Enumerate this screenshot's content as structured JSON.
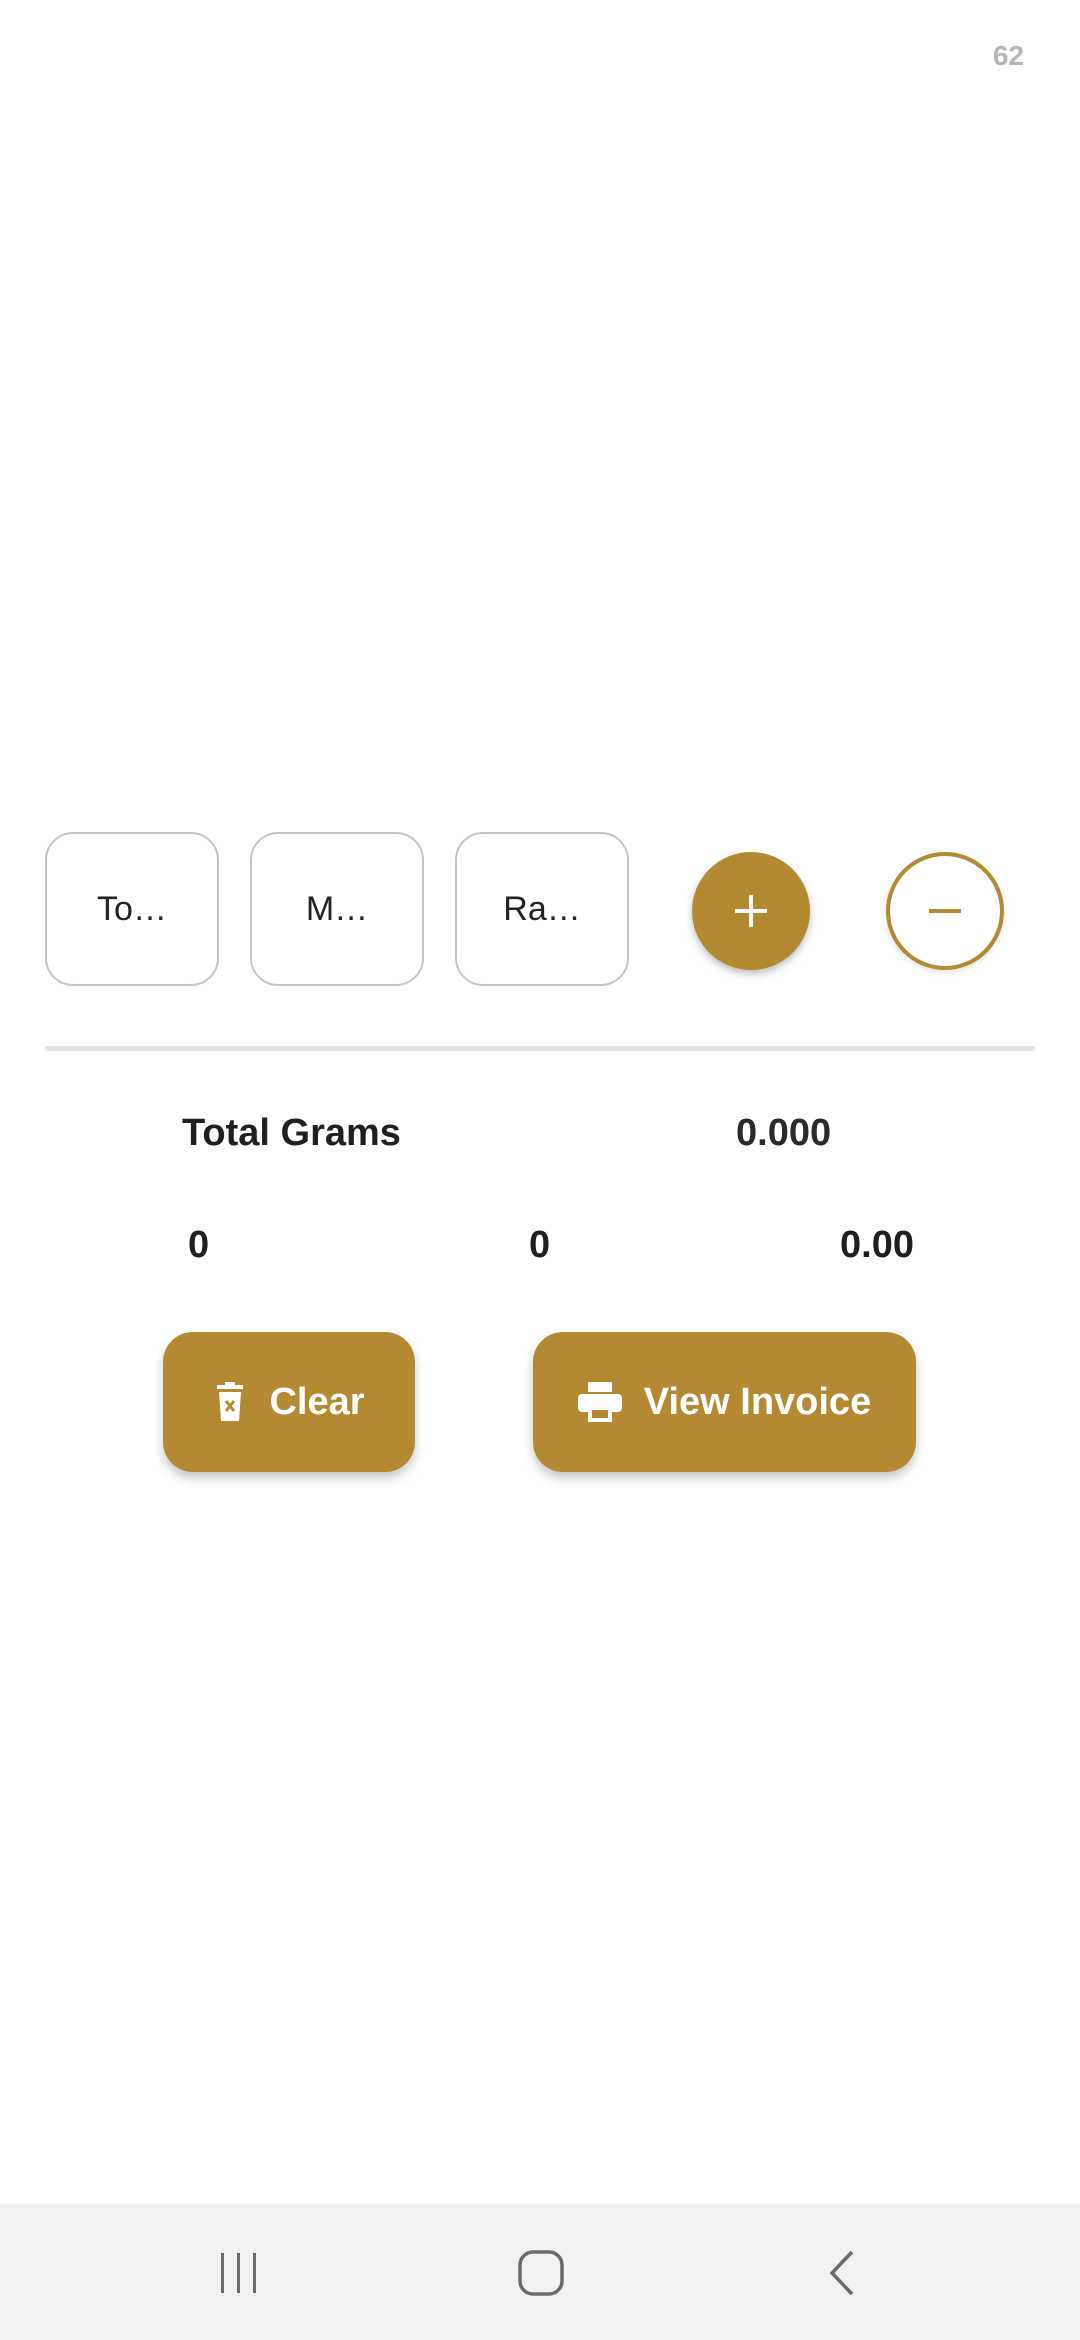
{
  "status": {
    "counter": "62"
  },
  "fields": [
    {
      "label": "To…"
    },
    {
      "label": "M…"
    },
    {
      "label": "Ra…"
    }
  ],
  "controls": {
    "add_icon": "plus-icon",
    "remove_icon": "minus-icon"
  },
  "summary": {
    "total_label": "Total Grams",
    "total_value": "0.000",
    "count_a": "0",
    "count_b": "0",
    "amount": "0.00"
  },
  "actions": {
    "clear_label": "Clear",
    "clear_icon": "trash-icon",
    "invoice_label": "View Invoice",
    "invoice_icon": "printer-icon"
  },
  "navigation": {
    "recent_icon": "recent-apps-icon",
    "home_icon": "home-icon",
    "back_icon": "back-icon"
  },
  "colors": {
    "accent": "#b38a32",
    "nav_background": "#f2f2f2"
  }
}
